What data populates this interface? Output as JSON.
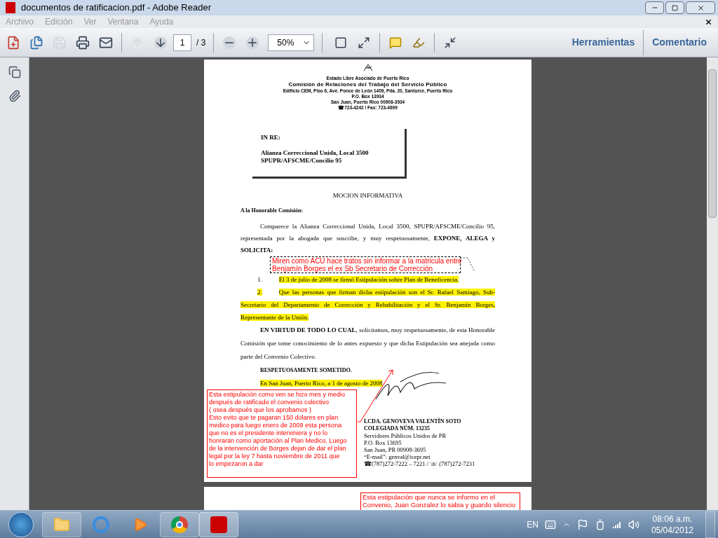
{
  "window": {
    "title": "documentos de ratificacion.pdf - Adobe Reader"
  },
  "menu": [
    "Archivo",
    "Edición",
    "Ver",
    "Ventana",
    "Ayuda"
  ],
  "toolbar": {
    "page": "1",
    "page_total": "/ 3",
    "zoom": "50%",
    "panels": [
      {
        "label": "Herramientas"
      },
      {
        "label": "Comentario"
      }
    ]
  },
  "document": {
    "letterhead": [
      "Estado Libre Asociado de Puerto Rico",
      "Comisión de Relaciones del Trabajo del Servicio Público",
      "Edificio CEM, Piso 6, Ave. Ponce de León 1409, Pda. 20, Santurce, Puerto Rico",
      "P.O. Box 13934",
      "San Juan, Puerto Rico 00908-3934",
      "☎723-4242 / Fax: 723-4699"
    ],
    "in_re": "IN RE:",
    "parties": [
      "Alianza Correccional Unida, Local 3500",
      "SPUPR/AFSCME/Concilio 95"
    ],
    "title": "MOCION INFORMATIVA",
    "salutation": "A la Honorable Comisión:",
    "intro": "Comparece la Alianza Correccional Unida, Local 3500, SPUPR/AFSCME/Concilio 95, representada por la abogada que suscribe, y muy respetuosamente, **EXPONE, ALEGA y SOLICITA:**",
    "items": [
      {
        "number": "1.",
        "text": "El 3 de julio de 2008 se firmó Estipulación sobre Plan de Beneficencia.",
        "highlighted": true
      },
      {
        "number": "2.",
        "text": "Que las personas que firman dicha estipulación son el Sr. Rafael Santiago, Sub-Secretario del Departamento de Corrección y Rehabilitación y el Sr. Benjamín Borges, Representante de la Unión.",
        "highlighted": true
      }
    ],
    "request": "**EN VIRTUD DE TODO LO CUAL**, solicitamos, muy respetuosamente, de esta Honorable Comisión que tome conocimiento de lo antes expuesto y  que dicha Estipulación sea anejada como parte del Convenio Colectivo.",
    "closing": "RESPETUOSAMENTE SOMETIDO.",
    "date_line": {
      "text": "En San Juan, Puerto Rico, a 1 de agosto de 2008",
      "highlighted": true
    },
    "signature": [
      "LCDA. GENOVEVA VALENTÍN SOTO",
      "COLEGIADA NÚM. 13235",
      "Servidores Públicos Unidos de PR",
      "P.O. Box 13695",
      "San Juan, PR  00908-3695",
      "“E-mail”: genval@icepr.net",
      "☎(787)272-7222 – 7221 / ☏ (787)272-7231"
    ]
  },
  "comments": [
    {
      "kind": "popup",
      "lines": [
        "Miren como ACU hace tratos sin informar a la matricula entre",
        "Benjamín Borges el ex Sb Secretario de Corrección"
      ]
    },
    {
      "kind": "callout",
      "lines": [
        "Esta estipulación como ven se hizo mes y medio",
        "después de ratificado el convenio colectivo",
        "( osea después que los aprobamos )",
        "Esto evito que te pagaran 150 dolares en plan",
        "medico para luego enero de 2009 esta persona",
        "que no es el presidente interviniera y no lo",
        "honraran como aportación al Plan Medico. Luego",
        "de la intervención de Borges dejan de dar el plan",
        "legal por la ley 7  hasta noviembre de 2011 que",
        "lo empezaron a dar"
      ]
    },
    {
      "kind": "textbox",
      "lines": [
        "Esta estipulación que nunca se  informo  en el",
        "Convenio, Juan Gonzalez lo sabia y guardo silencio"
      ]
    }
  ],
  "taskbar": {
    "language": "EN",
    "time": "08:06 a.m.",
    "date": "05/04/2012"
  }
}
